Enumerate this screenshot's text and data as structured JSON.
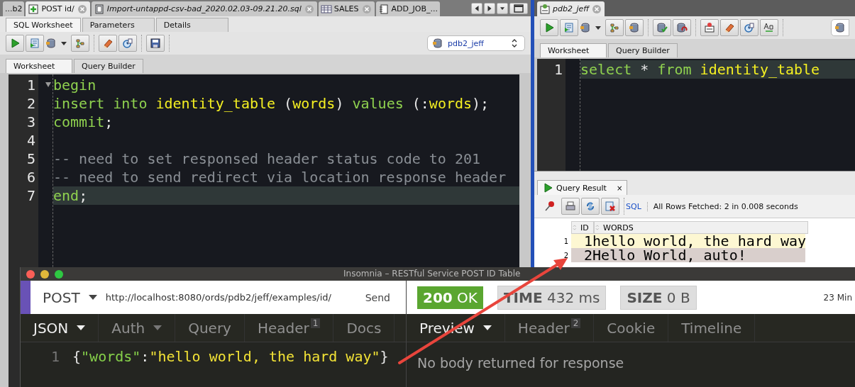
{
  "sql_developer": {
    "document_tabs": [
      {
        "label": "...b2",
        "selected": false
      },
      {
        "label": "POST id/",
        "selected": true
      },
      {
        "label": "Import-untappd-csv-bad_2020.02.03-09.21.20.sql",
        "selected": false
      },
      {
        "label": "SALES",
        "selected": false
      },
      {
        "label": "ADD_JOB_...",
        "selected": false
      }
    ],
    "left_worksheet": {
      "editor_tabs": [
        {
          "label": "SQL Worksheet",
          "selected": true
        },
        {
          "label": "Parameters",
          "selected": false
        },
        {
          "label": "Details",
          "selected": false
        }
      ],
      "connection": "pdb2_jeff",
      "sub_tabs": [
        {
          "label": "Worksheet",
          "selected": true
        },
        {
          "label": "Query Builder",
          "selected": false
        }
      ],
      "code_lines": [
        {
          "number": "1",
          "highlighted": false,
          "tokens": [
            {
              "text": "begin",
              "kind": "keyword"
            }
          ]
        },
        {
          "number": "2",
          "highlighted": false,
          "tokens": [
            {
              "text": "insert into ",
              "kind": "keyword"
            },
            {
              "text": "identity_table",
              "kind": "identifier"
            },
            {
              "text": " (",
              "kind": "plain"
            },
            {
              "text": "words",
              "kind": "identifier"
            },
            {
              "text": ") ",
              "kind": "plain"
            },
            {
              "text": "values",
              "kind": "keyword"
            },
            {
              "text": " (:",
              "kind": "plain"
            },
            {
              "text": "words",
              "kind": "identifier"
            },
            {
              "text": ");",
              "kind": "plain"
            }
          ]
        },
        {
          "number": "3",
          "highlighted": false,
          "tokens": [
            {
              "text": "commit",
              "kind": "keyword"
            },
            {
              "text": ";",
              "kind": "plain"
            }
          ]
        },
        {
          "number": "4",
          "highlighted": false
        },
        {
          "number": "5",
          "highlighted": false,
          "tokens": [
            {
              "text": "-- need to set responsed header status code to 201",
              "kind": "comment"
            }
          ]
        },
        {
          "number": "6",
          "highlighted": false,
          "tokens": [
            {
              "text": "-- need to send redirect via location response header",
              "kind": "comment"
            }
          ]
        },
        {
          "number": "7",
          "highlighted": true,
          "tokens": [
            {
              "text": "end",
              "kind": "keyword"
            },
            {
              "text": ";",
              "kind": "plain"
            }
          ]
        }
      ]
    },
    "right_worksheet": {
      "tab": "pdb2_jeff",
      "sub_tabs": [
        {
          "label": "Worksheet",
          "selected": true
        },
        {
          "label": "Query Builder",
          "selected": false
        }
      ],
      "code_lines": [
        {
          "number": "1",
          "highlighted": true,
          "tokens": [
            {
              "text": "select",
              "kind": "keyword"
            },
            {
              "text": " * ",
              "kind": "plain"
            },
            {
              "text": "from",
              "kind": "keyword"
            },
            {
              "text": " identity_table",
              "kind": "identifier"
            }
          ]
        }
      ],
      "result": {
        "tab": "Query Result",
        "close": "×",
        "sql_link": "SQL",
        "status": "All Rows Fetched: 2 in 0.008 seconds",
        "columns": [
          "ID",
          "WORDS"
        ],
        "rows": [
          {
            "row_number": "1",
            "id": "1",
            "words": "hello world, the hard way",
            "selected": false
          },
          {
            "row_number": "2",
            "id": "2",
            "words": "Hello World, auto!",
            "selected": true
          }
        ]
      }
    }
  },
  "insomnia": {
    "title": "Insomnia – RESTful Service POST ID Table",
    "method": "POST",
    "url": "http://localhost:8080/ords/pdb2/jeff/examples/id/",
    "send": "Send",
    "status": "**200** OK",
    "time": "**TIME** 432 ms",
    "size": "**SIZE** 0 B",
    "age": "23 Min",
    "request_tabs": [
      {
        "label": "JSON",
        "selected": true,
        "dropdown": true
      },
      {
        "label": "Auth",
        "selected": false,
        "dropdown": true
      },
      {
        "label": "Query",
        "selected": false
      },
      {
        "label": "Header",
        "selected": false,
        "badge": "1"
      },
      {
        "label": "Docs",
        "selected": false
      }
    ],
    "body_lines": [
      {
        "number": "1",
        "tokens": [
          {
            "text": "{",
            "kind": "plain"
          },
          {
            "text": "\"words\"",
            "kind": "key"
          },
          {
            "text": ":",
            "kind": "plain"
          },
          {
            "text": "\"hello world, the hard way\"",
            "kind": "string"
          },
          {
            "text": "}",
            "kind": "plain"
          }
        ]
      }
    ],
    "response_tabs": [
      {
        "label": "Preview",
        "selected": true,
        "dropdown": true
      },
      {
        "label": "Header",
        "selected": false,
        "badge": "2"
      },
      {
        "label": "Cookie",
        "selected": false
      },
      {
        "label": "Timeline",
        "selected": false
      }
    ],
    "response_message": "No body returned for response"
  }
}
